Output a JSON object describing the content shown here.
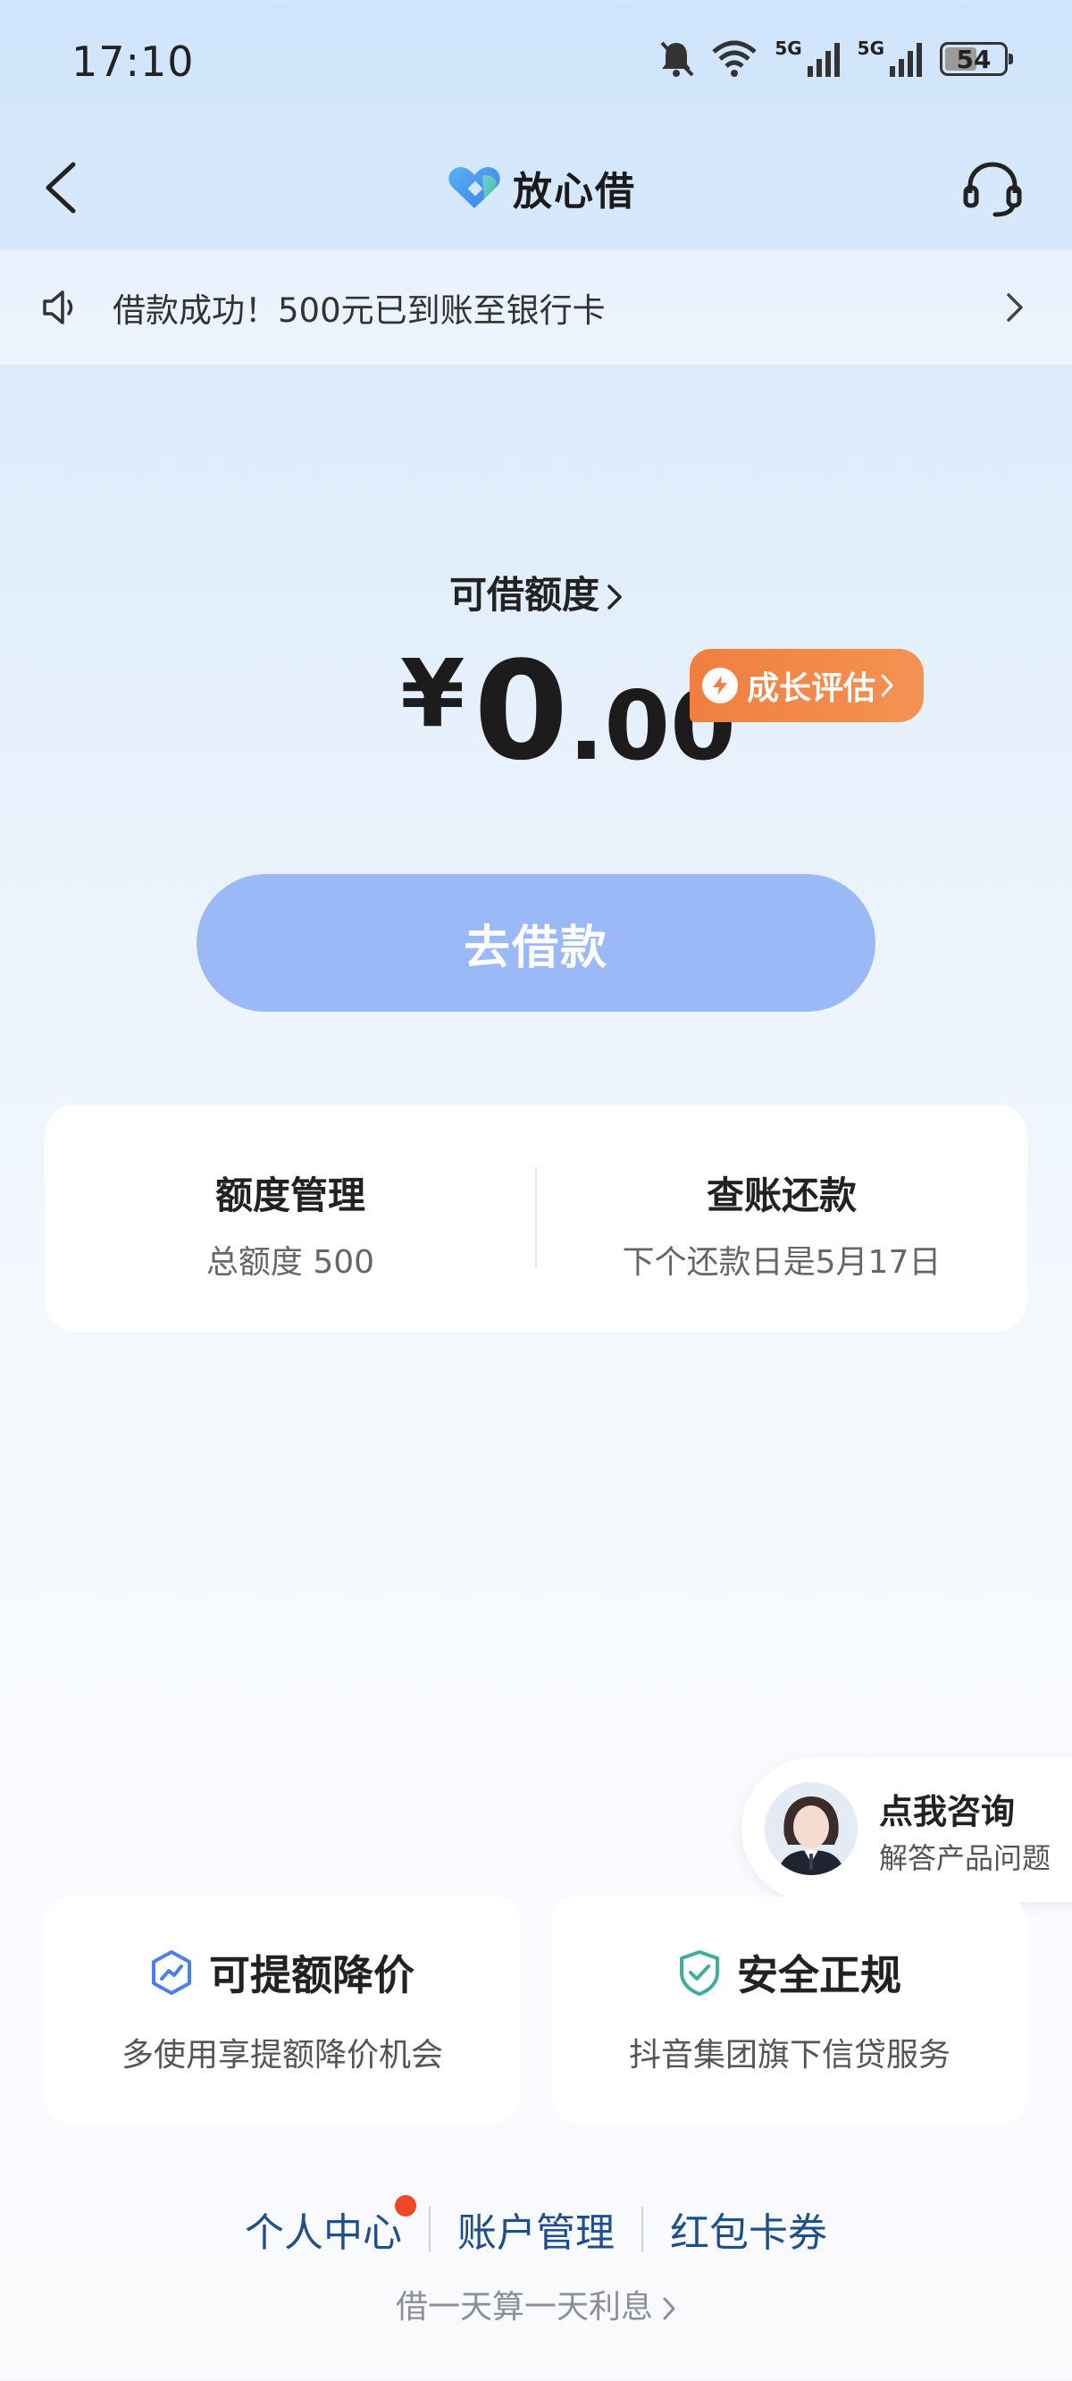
{
  "status_bar": {
    "time": "17:10",
    "battery": "54",
    "network_1": "5G",
    "network_2": "5G",
    "icons": [
      "mute-icon",
      "wifi-icon",
      "signal-icon",
      "signal-icon",
      "battery-icon"
    ]
  },
  "header": {
    "brand_name": "放心借",
    "back_icon": "back-arrow-icon",
    "support_icon": "headset-icon"
  },
  "notice": {
    "text": "借款成功！500元已到账至银行卡"
  },
  "credit": {
    "label": "可借额度",
    "currency": "¥",
    "amount_int": "0",
    "amount_dec": ".00",
    "growth_badge": "成长评估"
  },
  "borrow_button": "去借款",
  "management": {
    "quota_title": "额度管理",
    "quota_sub": "总额度 500",
    "repay_title": "查账还款",
    "repay_sub": "下个还款日是5月17日"
  },
  "consult": {
    "title": "点我咨询",
    "subtitle": "解答产品问题"
  },
  "features": [
    {
      "title": "可提额降价",
      "subtitle": "多使用享提额降价机会"
    },
    {
      "title": "安全正规",
      "subtitle": "抖音集团旗下信贷服务"
    }
  ],
  "bottom_links": [
    "个人中心",
    "账户管理",
    "红包卡券"
  ],
  "interest_note": "借一天算一天利息",
  "colors": {
    "primary_button": "#9bb9f6",
    "badge_orange": "#f07f40",
    "link_blue": "#1f4e8c",
    "notification_dot": "#ee4a2a"
  }
}
